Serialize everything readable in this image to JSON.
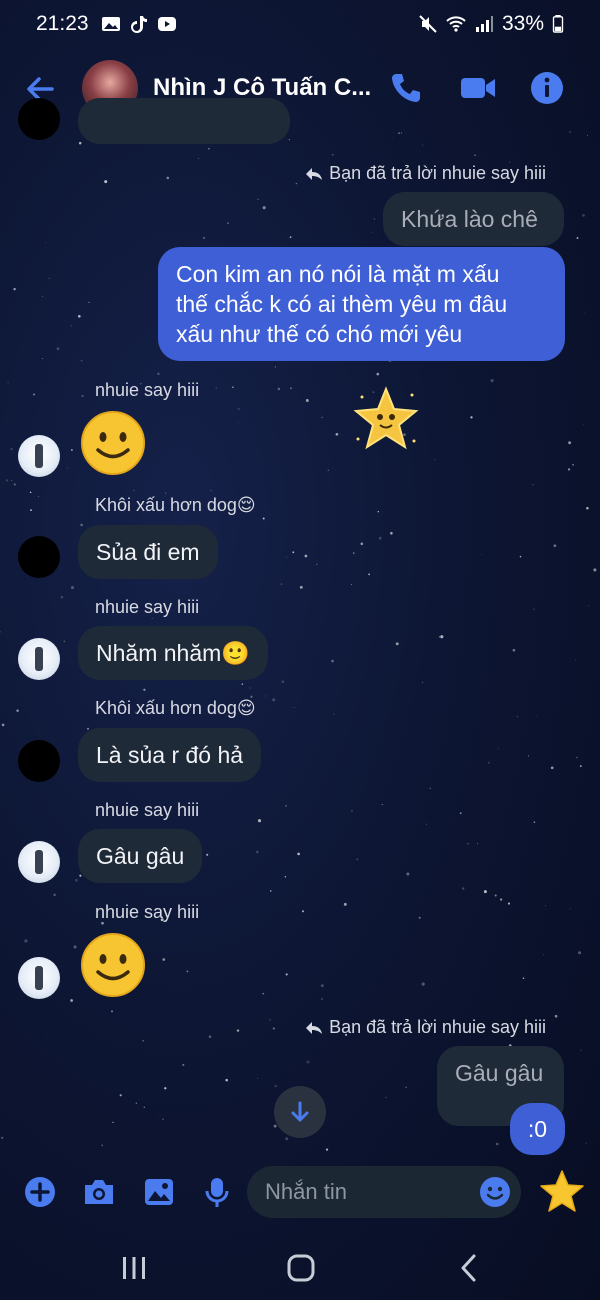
{
  "status_bar": {
    "time": "21:23",
    "battery": "33%",
    "icons": [
      "gallery-icon",
      "tiktok-icon",
      "youtube-icon",
      "mute-icon",
      "wifi-icon",
      "signal-icon",
      "battery-icon"
    ]
  },
  "header": {
    "title": "Nhìn J Cô Tuấn C...",
    "online": true,
    "actions": [
      "phone-icon",
      "video-call-icon",
      "info-icon"
    ]
  },
  "messages": [
    {
      "type": "reply_note",
      "text": "Bạn đã trả lời nhuie say hiii"
    },
    {
      "type": "quoted",
      "text": "Khứa lào chê"
    },
    {
      "type": "outgoing",
      "lines": [
        "Con kim an nó nói là mặt m xấu",
        "thế chắc k có ai thèm yêu m đâu",
        "xấu như thế có chó mới yêu"
      ]
    },
    {
      "type": "incoming",
      "sender": "nhuie say hiii",
      "emoji": "slightly-smiling-face"
    },
    {
      "type": "incoming",
      "sender": "Khôi xấu hơn dog😌",
      "text": "Sủa đi em"
    },
    {
      "type": "incoming",
      "sender": "nhuie say hiii",
      "text": "Nhăm nhăm🙂"
    },
    {
      "type": "incoming",
      "sender": "Khôi xấu hơn dog😌",
      "text": "Là sủa r đó hả"
    },
    {
      "type": "incoming",
      "sender": "nhuie say hiii",
      "text": "Gâu gâu"
    },
    {
      "type": "incoming",
      "sender": "nhuie say hiii",
      "emoji": "slightly-smiling-face"
    },
    {
      "type": "reply_note",
      "text": "Bạn đã trả lời nhuie say hiii"
    },
    {
      "type": "quoted",
      "text": "Gâu gâu"
    },
    {
      "type": "outgoing",
      "text": ":0"
    }
  ],
  "composer": {
    "placeholder": "Nhắn tin",
    "icons": [
      "plus-icon",
      "camera-icon",
      "image-icon",
      "microphone-icon",
      "emoji-icon",
      "star-icon"
    ]
  },
  "colors": {
    "accent": "#4a7cf0",
    "outgoing_bubble": "#3f5fd6",
    "incoming_bubble": "#1f2a38",
    "background": "#0b1230",
    "online": "#31c04f"
  }
}
